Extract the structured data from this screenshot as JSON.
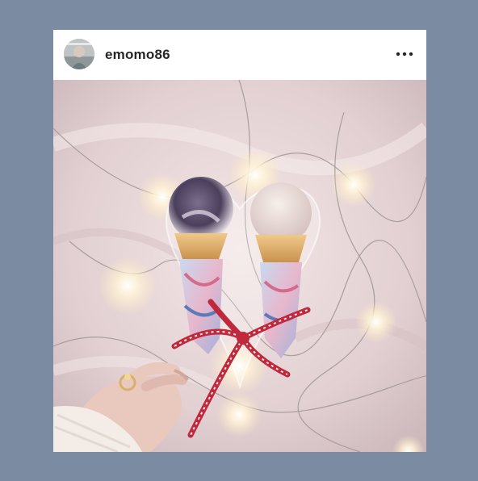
{
  "post": {
    "username": "emomo86",
    "more_icon": "more-horizontal-icon",
    "avatar_icon": "profile-avatar",
    "photo_subject": "ice-cream-cones-with-fairy-lights"
  },
  "colors": {
    "background": "#7b8ba1",
    "card": "#ffffff",
    "username": "#262626",
    "ribbon": "#c0283c"
  }
}
